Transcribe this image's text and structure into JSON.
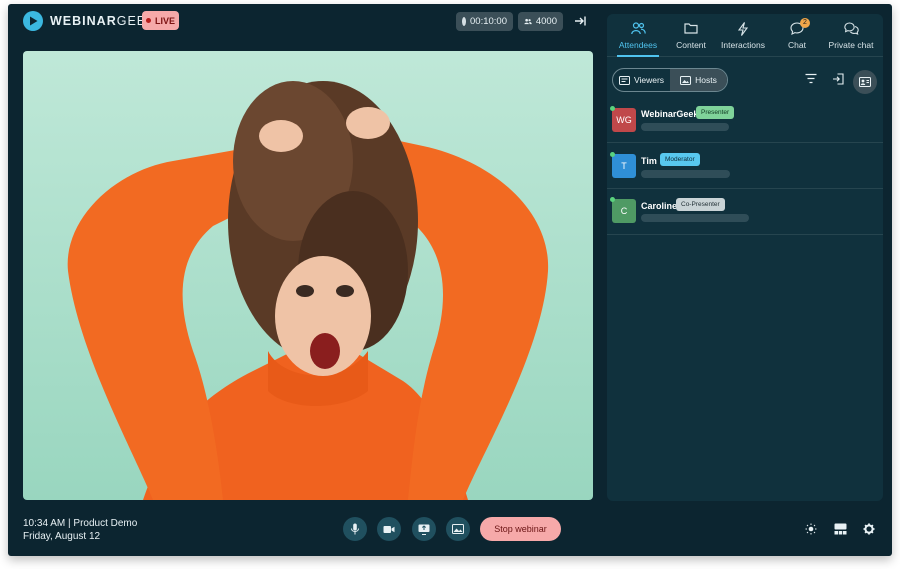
{
  "app": {
    "brand_bold": "WEBINAR",
    "brand_rest": "GEEK",
    "live_label": "LIVE"
  },
  "topbar": {
    "timer": "00:10:00",
    "viewer_count": "4000"
  },
  "footer": {
    "time_title": "10:34 AM | Product Demo",
    "date": "Friday, August 12",
    "stop_label": "Stop webinar"
  },
  "panel": {
    "tabs": [
      {
        "label": "Attendees",
        "icon": "people-icon"
      },
      {
        "label": "Content",
        "icon": "folder-icon"
      },
      {
        "label": "Interactions",
        "icon": "lightning-icon"
      },
      {
        "label": "Chat",
        "icon": "chat-icon",
        "badge": "2"
      },
      {
        "label": "Private chat",
        "icon": "private-chat-icon"
      }
    ],
    "toggle": {
      "viewers": "Viewers",
      "hosts": "Hosts"
    },
    "hosts": [
      {
        "initials": "WG",
        "name": "WebinarGeek",
        "role": "Presenter",
        "avatar_color": "#c0484a",
        "role_bg": "#7fd39a",
        "role_fg": "#0f3a22"
      },
      {
        "initials": "T",
        "name": "Tim",
        "role": "Moderator",
        "avatar_color": "#2f8fd6",
        "role_bg": "#58c8ef",
        "role_fg": "#0b2a38"
      },
      {
        "initials": "C",
        "name": "Caroline",
        "role": "Co-Presenter",
        "avatar_color": "#4f9a64",
        "role_bg": "#c9d3d6",
        "role_fg": "#1f2d33"
      }
    ]
  },
  "colors": {
    "accent": "#50c4ef",
    "live": "#f6a9a9",
    "background": "#0c2530"
  }
}
